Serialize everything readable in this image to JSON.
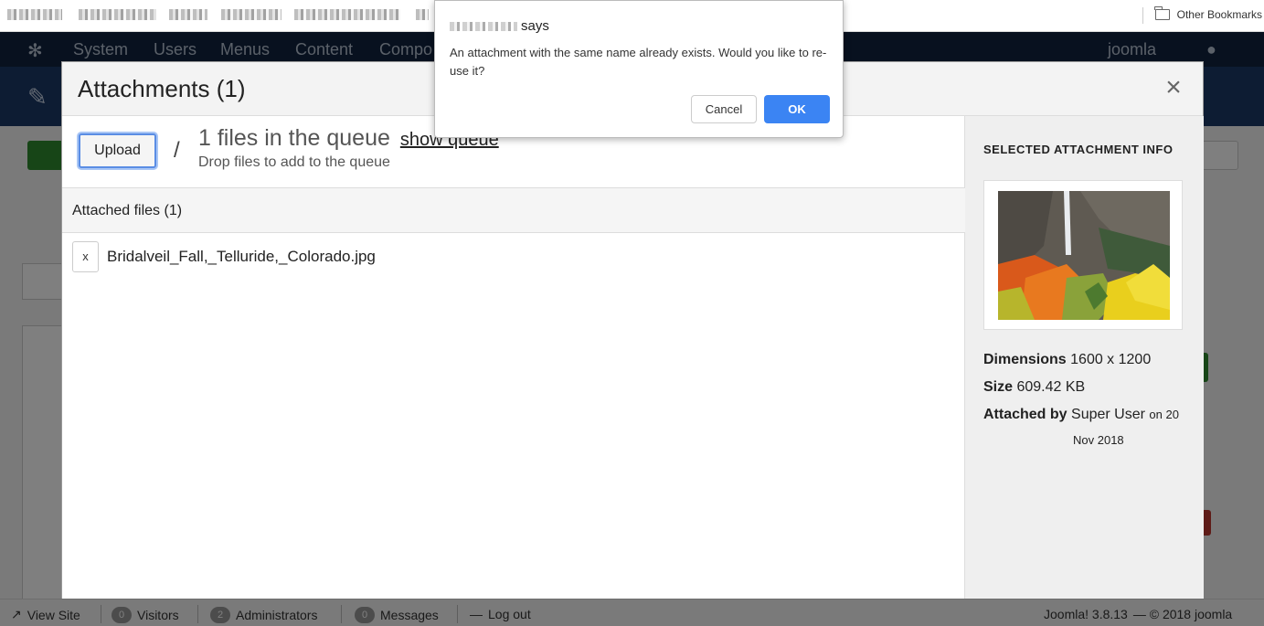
{
  "browser": {
    "other_bookmarks": "Other Bookmarks"
  },
  "joomla": {
    "nav": [
      "System",
      "Users",
      "Menus",
      "Content",
      "Compo"
    ],
    "user_link": "joomla",
    "footer": {
      "view_site": "View Site",
      "visitors_count": "0",
      "visitors_label": "Visitors",
      "admins_count": "2",
      "admins_label": "Administrators",
      "messages_count": "0",
      "messages_label": "Messages",
      "logout": "Log out",
      "version": "Joomla! 3.8.13",
      "copyright": "— © 2018 joomla"
    }
  },
  "modal": {
    "title": "Attachments (1)",
    "close_symbol": "×",
    "upload_label": "Upload",
    "slash": "/",
    "queue_text": "1 files in the queue",
    "queue_link": "show queue",
    "drop_text": "Drop files to add to the queue",
    "attached_header": "Attached files (1)",
    "files": [
      {
        "remove_label": "x",
        "name": "Bridalveil_Fall,_Telluride,_Colorado.jpg"
      }
    ],
    "info": {
      "title": "SELECTED ATTACHMENT INFO",
      "dimensions_label": "Dimensions",
      "dimensions_value": "1600 x 1200",
      "size_label": "Size",
      "size_value": "609.42 KB",
      "attached_by_label": "Attached by",
      "attached_by_value": "Super User",
      "on_text": "on 20",
      "date_rest": "Nov 2018"
    }
  },
  "alert": {
    "says": "says",
    "message": "An attachment with the same name already exists. Would you like to re-use it?",
    "cancel_label": "Cancel",
    "ok_label": "OK",
    "ok_color": "#3b84f3"
  }
}
